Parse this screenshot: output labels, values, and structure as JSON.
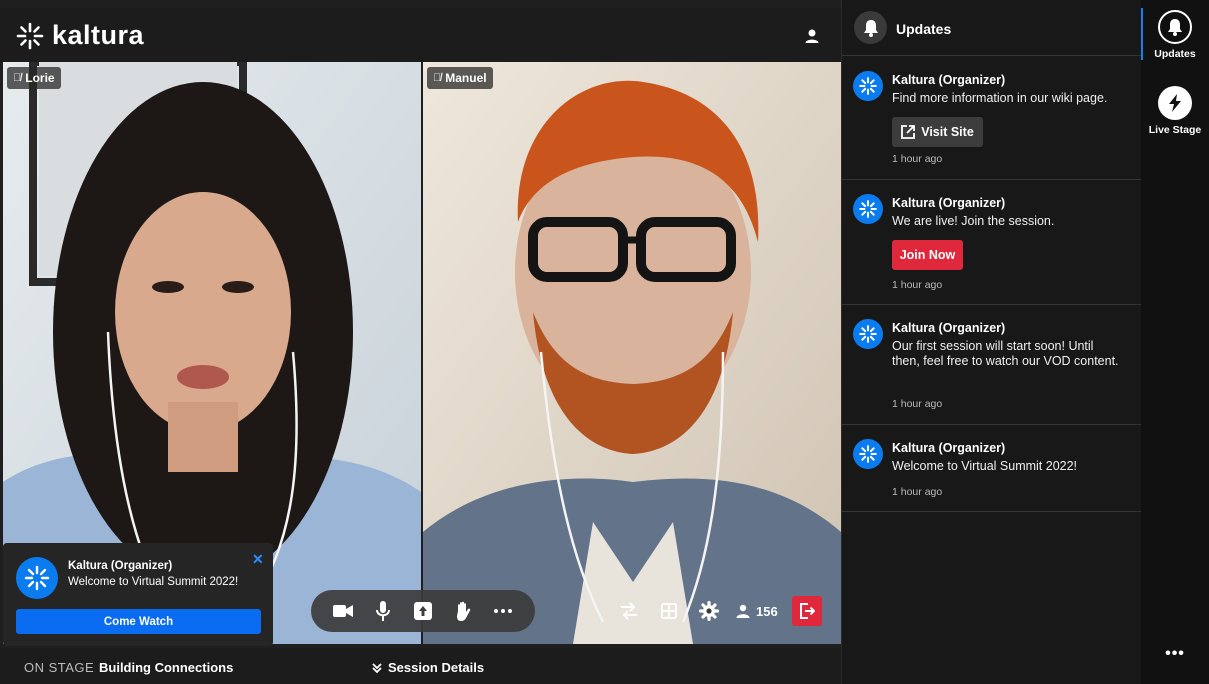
{
  "app": {
    "brand": "kaltura",
    "brand_color": "#0a7cf0",
    "accent_red": "#e0283c"
  },
  "videos": [
    {
      "name": "Lorie",
      "muted": true
    },
    {
      "name": "Manuel",
      "muted": true
    }
  ],
  "toast": {
    "sender": "Kaltura (Organizer)",
    "message": "Welcome to Virtual Summit 2022!",
    "button": "Come Watch",
    "close_icon": "close-icon"
  },
  "controls": {
    "left": [
      "camera-icon",
      "microphone-icon",
      "share-screen-icon",
      "raise-hand-icon",
      "more-icon"
    ],
    "right": [
      "switch-layout-icon",
      "grid-icon",
      "settings-icon"
    ],
    "attendee_count": "156",
    "leave_icon": "leave-icon"
  },
  "bottom_bar": {
    "on_stage_label": "ON STAGE",
    "session_title": "Building Connections",
    "session_details": "Session Details"
  },
  "updates": {
    "title": "Updates",
    "items": [
      {
        "sender": "Kaltura (Organizer)",
        "message": "Find more information in our wiki page.",
        "button": "Visit Site",
        "time": "1 hour ago"
      },
      {
        "sender": "Kaltura (Organizer)",
        "message": "We are live! Join the session.",
        "button": "Join Now",
        "time": "1 hour ago"
      },
      {
        "sender": "Kaltura (Organizer)",
        "message": "Our first session will start soon! Until then, feel free to watch our VOD content.",
        "time": "1 hour ago"
      },
      {
        "sender": "Kaltura (Organizer)",
        "message": "Welcome to Virtual Summit 2022!",
        "time": "1 hour ago"
      }
    ]
  },
  "rail": {
    "items": [
      {
        "label": "Updates",
        "icon": "bell-icon",
        "active": true
      },
      {
        "label": "Live Stage",
        "icon": "lightning-icon",
        "active": false
      }
    ],
    "more": "•••"
  }
}
